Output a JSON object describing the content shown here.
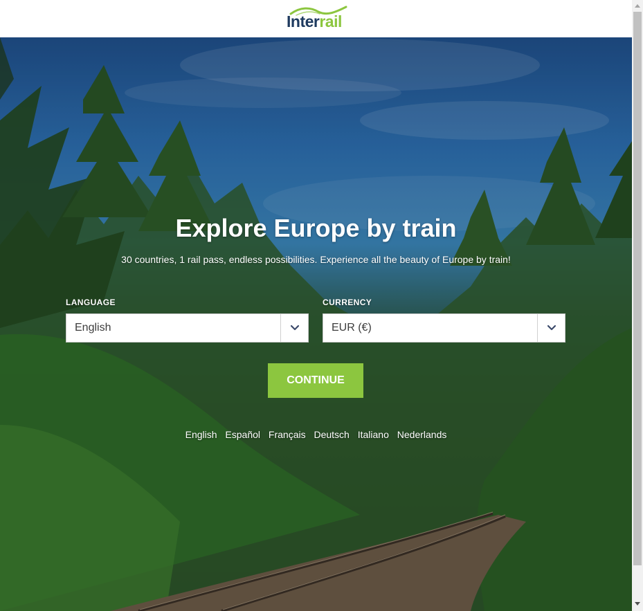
{
  "header": {
    "logo_part1": "Inter",
    "logo_part2": "rail"
  },
  "hero": {
    "title": "Explore Europe by train",
    "subtitle": "30 countries, 1 rail pass, endless possibilities. Experience all the beauty of Europe by train!"
  },
  "form": {
    "language_label": "LANGUAGE",
    "language_value": "English",
    "currency_label": "CURRENCY",
    "currency_value": "EUR (€)",
    "continue_label": "CONTINUE"
  },
  "languages": [
    "English",
    "Español",
    "Français",
    "Deutsch",
    "Italiano",
    "Nederlands"
  ],
  "colors": {
    "brand_green": "#8cc63f",
    "brand_navy": "#1e3a5f"
  },
  "icons": {
    "dropdown": "chevron-down-icon",
    "scroll_up": "scroll-up-arrow-icon",
    "scroll_down": "scroll-down-arrow-icon"
  }
}
